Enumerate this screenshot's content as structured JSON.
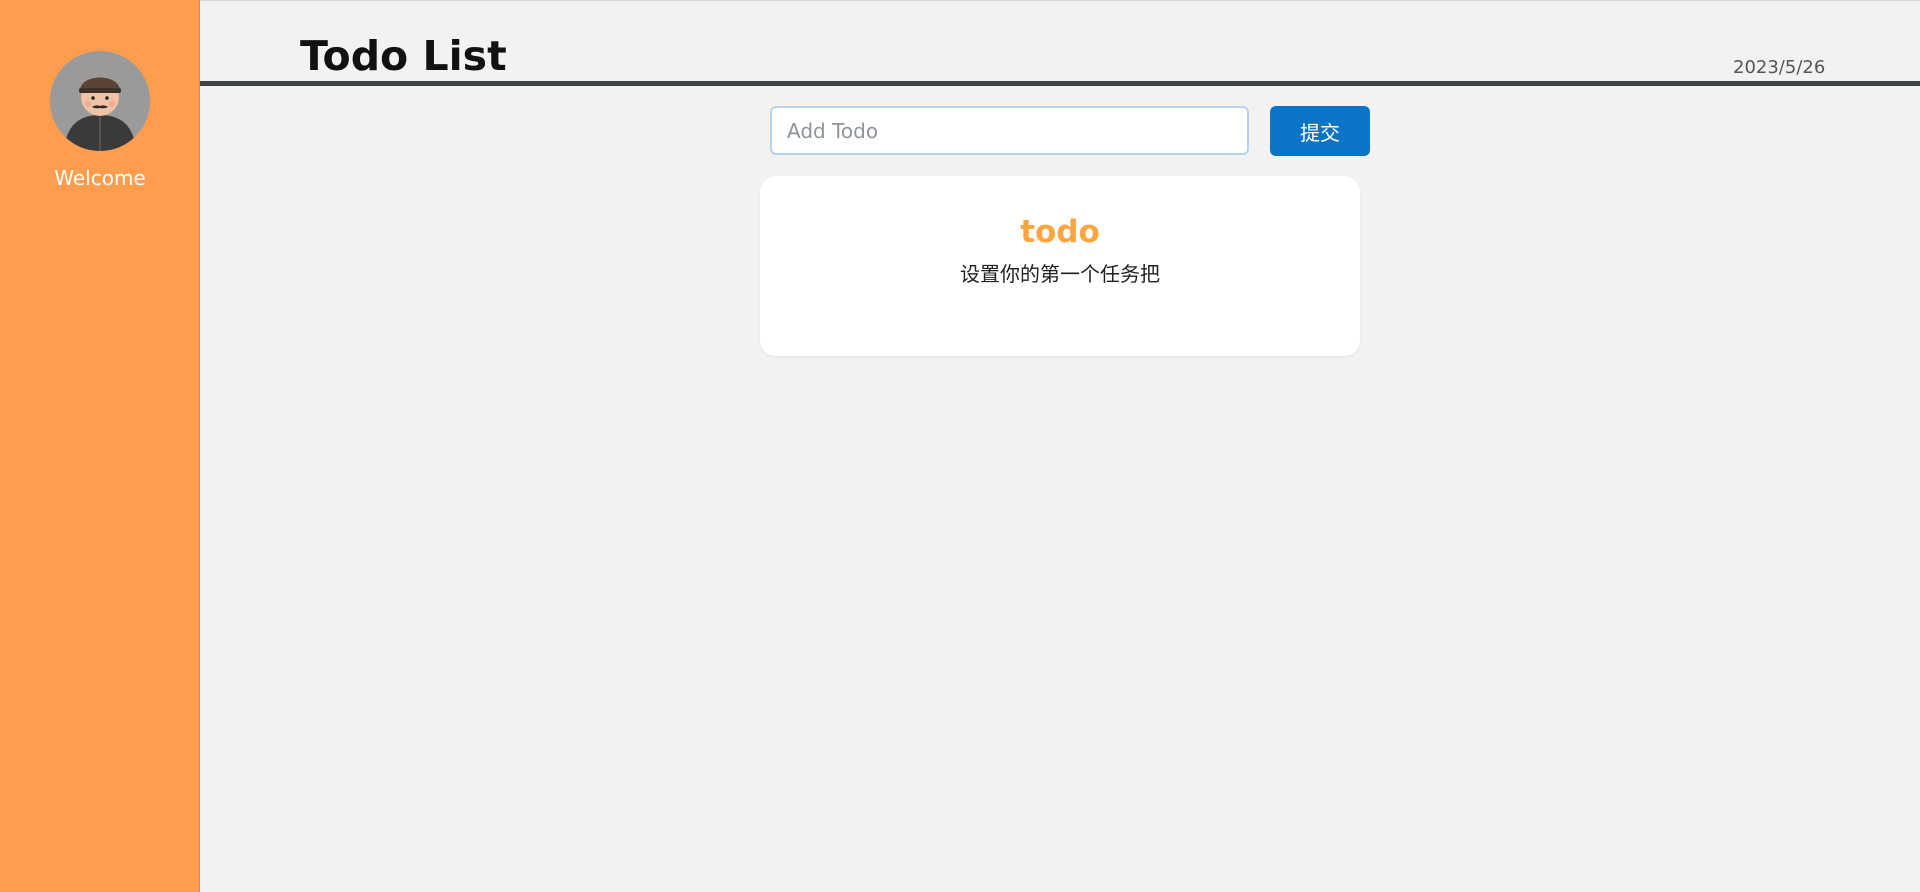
{
  "sidebar": {
    "welcome_text": "Welcome",
    "avatar_icon": "user-avatar-icon",
    "background_color": "#ff9d4f"
  },
  "header": {
    "title": "Todo List",
    "date": "2023/5/26"
  },
  "todo_form": {
    "input_value": "",
    "input_placeholder": "Add Todo",
    "submit_label": "提交",
    "submit_color": "#0a74c6"
  },
  "empty_state": {
    "title": "todo",
    "subtitle": "设置你的第一个任务把",
    "title_color": "#ffa540"
  }
}
